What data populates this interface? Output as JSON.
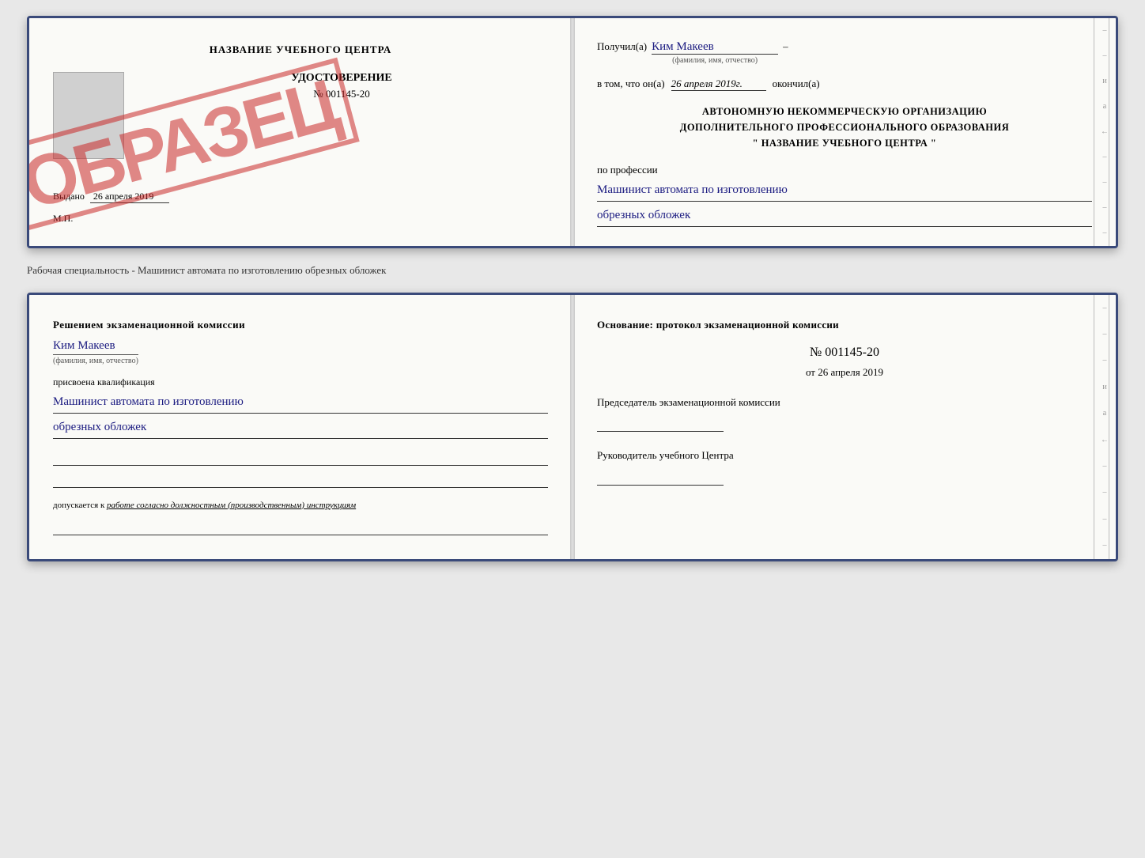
{
  "top_document": {
    "left": {
      "title": "НАЗВАНИЕ УЧЕБНОГО ЦЕНТРА",
      "stamp": "ОБРАЗЕЦ",
      "cert_title": "УДОСТОВЕРЕНИЕ",
      "cert_number": "№ 001145-20",
      "issued_label": "Выдано",
      "issued_date": "26 апреля 2019",
      "mp_label": "М.П."
    },
    "right": {
      "recipient_prefix": "Получил(а)",
      "recipient_name": "Ким Макеев",
      "recipient_sublabel": "(фамилия, имя, отчество)",
      "date_prefix": "в том, что он(а)",
      "date_value": "26 апреля 2019г.",
      "date_suffix": "окончил(а)",
      "org_line1": "АВТОНОМНУЮ НЕКОММЕРЧЕСКУЮ ОРГАНИЗАЦИЮ",
      "org_line2": "ДОПОЛНИТЕЛЬНОГО ПРОФЕССИОНАЛЬНОГО ОБРАЗОВАНИЯ",
      "org_line3": "\"   НАЗВАНИЕ УЧЕБНОГО ЦЕНТРА   \"",
      "profession_prefix": "по профессии",
      "profession_line1": "Машинист автомата по изготовлению",
      "profession_line2": "обрезных обложек"
    }
  },
  "separator": "Рабочая специальность - Машинист автомата по изготовлению обрезных обложек",
  "bottom_document": {
    "left": {
      "decision_title": "Решением экзаменационной комиссии",
      "decision_name": "Ким Макеев",
      "fio_label": "(фамилия, имя, отчество)",
      "qualification_label": "присвоена квалификация",
      "qualification_line1": "Машинист автомата по изготовлению",
      "qualification_line2": "обрезных обложек",
      "допускается_text": "допускается к",
      "допускается_underline": "работе согласно должностным (производственным) инструкциям"
    },
    "right": {
      "osnov_text": "Основание: протокол экзаменационной комиссии",
      "protocol_number": "№ 001145-20",
      "from_prefix": "от",
      "from_date": "26 апреля 2019",
      "chairman_title": "Председатель экзаменационной комиссии",
      "rukovoditel_title": "Руководитель учебного Центра"
    }
  }
}
